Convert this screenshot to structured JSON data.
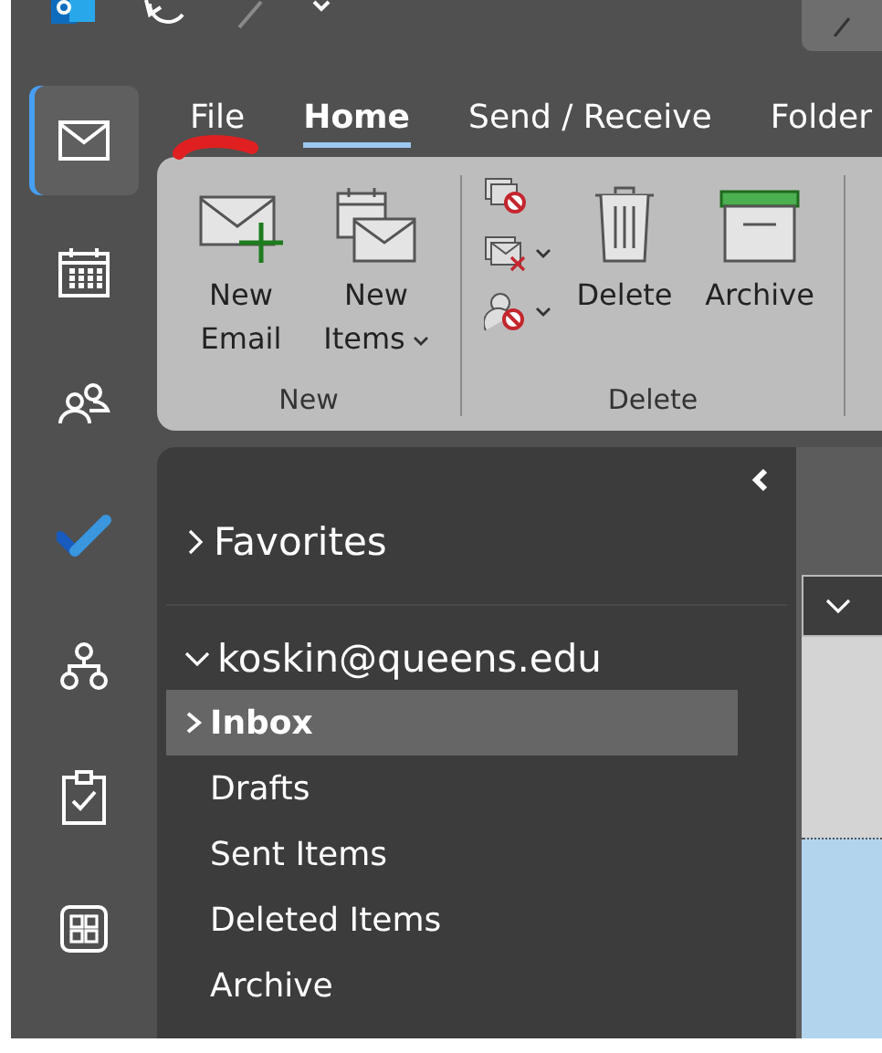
{
  "rail": [
    {
      "kind": "mail",
      "selected": true
    },
    {
      "kind": "calendar",
      "selected": false
    },
    {
      "kind": "people",
      "selected": false
    },
    {
      "kind": "todo",
      "selected": false
    },
    {
      "kind": "org",
      "selected": false
    },
    {
      "kind": "tasks",
      "selected": false
    },
    {
      "kind": "apps",
      "selected": false
    }
  ],
  "tabs": [
    {
      "label": "File",
      "selected": false
    },
    {
      "label": "Home",
      "selected": true
    },
    {
      "label": "Send / Receive",
      "selected": false
    },
    {
      "label": "Folder",
      "selected": false
    }
  ],
  "ribbon_groups": [
    {
      "label": "New",
      "buttons": [
        {
          "kind": "new-email",
          "label": "New Email",
          "dropdown": false
        },
        {
          "kind": "new-items",
          "label": "New Items",
          "dropdown": true
        }
      ]
    },
    {
      "label": "Delete",
      "small_buttons": [
        {
          "kind": "ignore",
          "dropdown": false
        },
        {
          "kind": "clean-up",
          "dropdown": true
        },
        {
          "kind": "junk",
          "dropdown": true
        }
      ],
      "buttons": [
        {
          "kind": "delete",
          "label": "Delete",
          "dropdown": false
        },
        {
          "kind": "archive",
          "label": "Archive",
          "dropdown": false
        }
      ]
    }
  ],
  "folder_pane": {
    "favorites": {
      "label": "Favorites",
      "expanded": false
    },
    "account": {
      "label": "koskin@queens.edu",
      "expanded": true,
      "folders": [
        {
          "label": "Inbox",
          "selected": true,
          "has_children": true
        },
        {
          "label": "Drafts",
          "selected": false,
          "has_children": false
        },
        {
          "label": "Sent Items",
          "selected": false,
          "has_children": false
        },
        {
          "label": "Deleted Items",
          "selected": false,
          "has_children": false
        },
        {
          "label": "Archive",
          "selected": false,
          "has_children": false
        }
      ]
    }
  }
}
